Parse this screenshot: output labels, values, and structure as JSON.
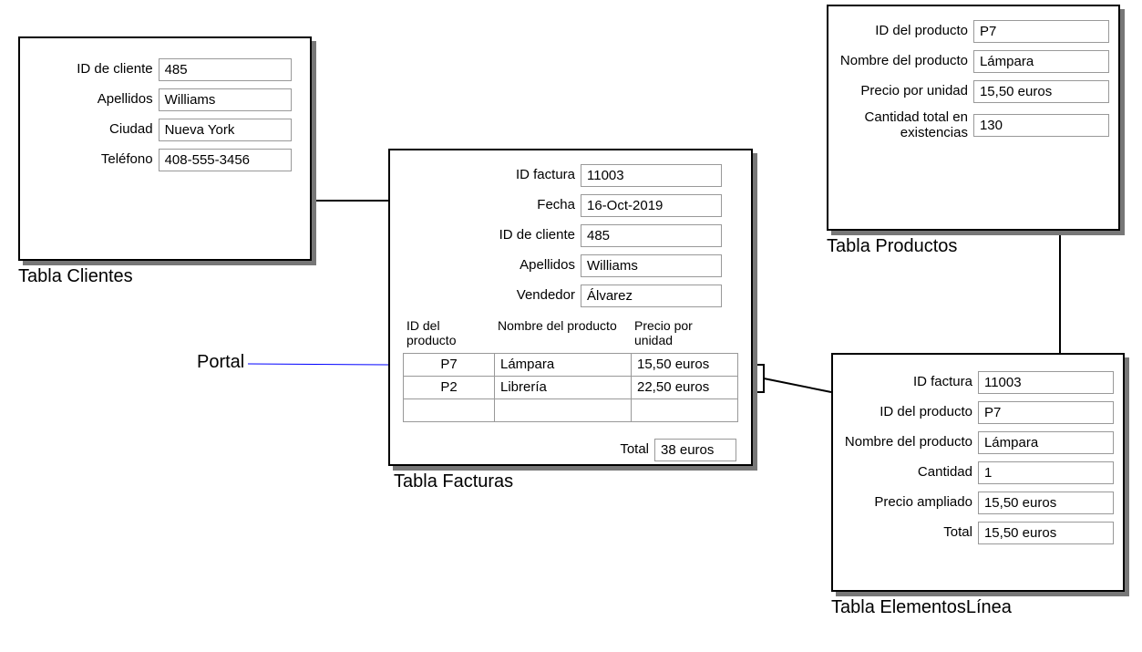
{
  "clientes": {
    "title": "Tabla Clientes",
    "fields": {
      "id_cliente": {
        "label": "ID de cliente",
        "value": "485"
      },
      "apellidos": {
        "label": "Apellidos",
        "value": "Williams"
      },
      "ciudad": {
        "label": "Ciudad",
        "value": "Nueva York"
      },
      "telefono": {
        "label": "Teléfono",
        "value": "408-555-3456"
      }
    }
  },
  "productos": {
    "title": "Tabla Productos",
    "fields": {
      "id_producto": {
        "label": "ID del producto",
        "value": "P7"
      },
      "nombre_producto": {
        "label": "Nombre del producto",
        "value": "Lámpara"
      },
      "precio_unidad": {
        "label": "Precio por unidad",
        "value": "15,50 euros"
      },
      "cantidad_total": {
        "label": "Cantidad total en existencias",
        "value": "130"
      }
    }
  },
  "facturas": {
    "title": "Tabla Facturas",
    "portal_label": "Portal",
    "fields": {
      "id_factura": {
        "label": "ID factura",
        "value": "11003"
      },
      "fecha": {
        "label": "Fecha",
        "value": "16-Oct-2019"
      },
      "id_cliente": {
        "label": "ID de cliente",
        "value": "485"
      },
      "apellidos": {
        "label": "Apellidos",
        "value": "Williams"
      },
      "vendedor": {
        "label": "Vendedor",
        "value": "Álvarez"
      }
    },
    "portal": {
      "columns": {
        "id_producto": "ID del producto",
        "nombre_producto": "Nombre del producto",
        "precio_unidad": "Precio por unidad"
      },
      "rows": [
        {
          "id_producto": "P7",
          "nombre_producto": "Lámpara",
          "precio_unidad": "15,50 euros"
        },
        {
          "id_producto": "P2",
          "nombre_producto": "Librería",
          "precio_unidad": "22,50 euros"
        },
        {
          "id_producto": "",
          "nombre_producto": "",
          "precio_unidad": ""
        }
      ]
    },
    "total": {
      "label": "Total",
      "value": "38 euros"
    }
  },
  "elementos": {
    "title": "Tabla ElementosLínea",
    "fields": {
      "id_factura": {
        "label": "ID factura",
        "value": "11003"
      },
      "id_producto": {
        "label": "ID del producto",
        "value": "P7"
      },
      "nombre_producto": {
        "label": "Nombre del producto",
        "value": "Lámpara"
      },
      "cantidad": {
        "label": "Cantidad",
        "value": "1"
      },
      "precio_ampliado": {
        "label": "Precio ampliado",
        "value": "15,50 euros"
      },
      "total": {
        "label": "Total",
        "value": "15,50 euros"
      }
    }
  }
}
